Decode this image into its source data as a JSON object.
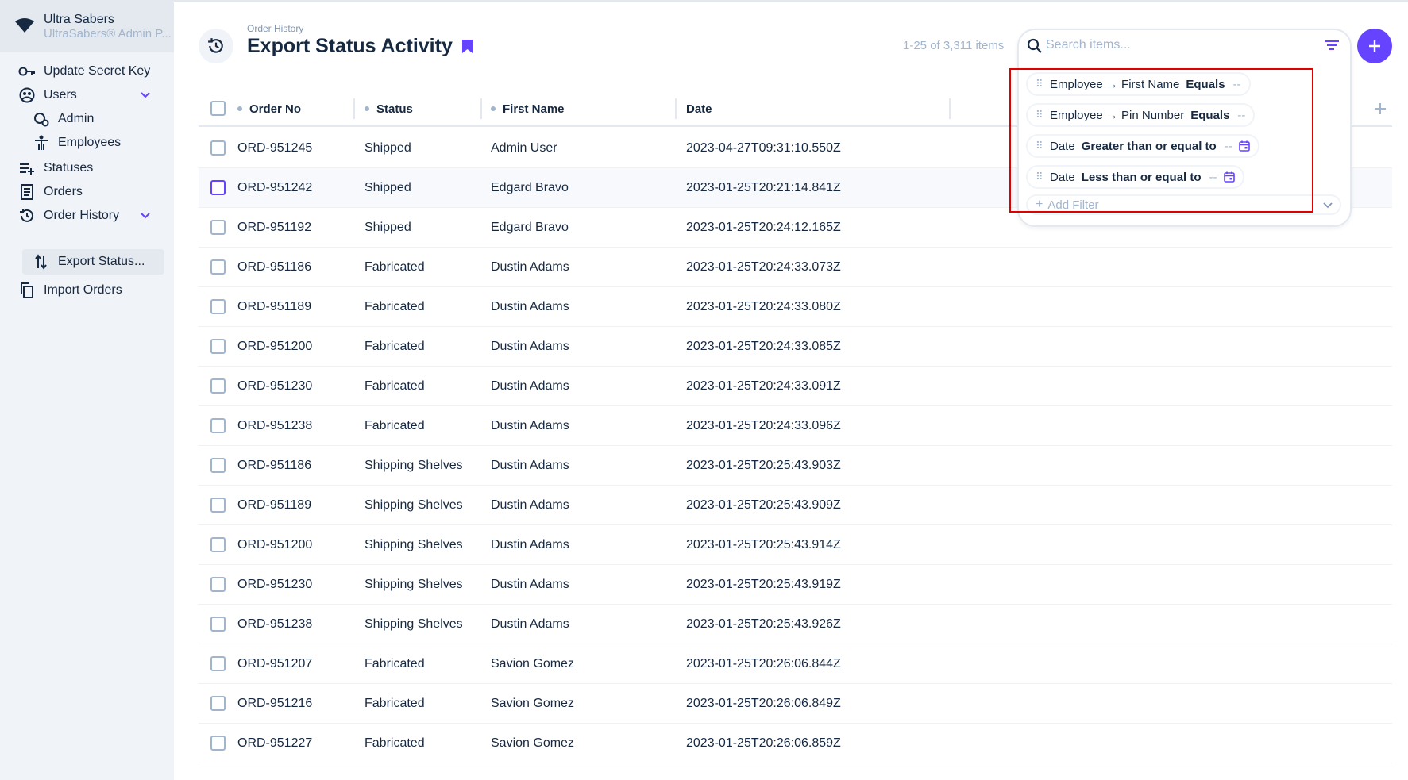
{
  "sidebar": {
    "brand_name": "Ultra Sabers",
    "brand_sub": "UltraSabers® Admin P...",
    "items": [
      {
        "label": "Update Secret Key",
        "icon": "key-icon"
      },
      {
        "label": "Users",
        "icon": "users-icon"
      },
      {
        "label": "Admin",
        "icon": "admin-icon"
      },
      {
        "label": "Employees",
        "icon": "employee-icon"
      },
      {
        "label": "Statuses",
        "icon": "playlist-add-icon"
      },
      {
        "label": "Orders",
        "icon": "receipt-icon"
      },
      {
        "label": "Order History",
        "icon": "history-icon"
      },
      {
        "label": "Export Status...",
        "icon": "swap-vert-icon"
      },
      {
        "label": "Import Orders",
        "icon": "copy-icon"
      }
    ]
  },
  "header": {
    "breadcrumb": "Order History",
    "title": "Export Status Activity",
    "count": "1-25 of 3,311 items"
  },
  "search": {
    "placeholder": "Search items...",
    "filters": [
      {
        "field": "Employee → First Name",
        "operator": "Equals",
        "value": "--",
        "has_calendar": false
      },
      {
        "field": "Employee → Pin Number",
        "operator": "Equals",
        "value": "--",
        "has_calendar": false
      },
      {
        "field": "Date",
        "operator": "Greater than or equal to",
        "value": "--",
        "has_calendar": true
      },
      {
        "field": "Date",
        "operator": "Less than or equal to",
        "value": "--",
        "has_calendar": true
      }
    ],
    "add_filter": "Add Filter"
  },
  "table": {
    "columns": [
      "Order No",
      "Status",
      "First Name",
      "Date"
    ],
    "rows": [
      [
        "ORD-951245",
        "Shipped",
        "Admin User",
        "2023-04-27T09:31:10.550Z"
      ],
      [
        "ORD-951242",
        "Shipped",
        "Edgard Bravo",
        "2023-01-25T20:21:14.841Z"
      ],
      [
        "ORD-951192",
        "Shipped",
        "Edgard Bravo",
        "2023-01-25T20:24:12.165Z"
      ],
      [
        "ORD-951186",
        "Fabricated",
        "Dustin Adams",
        "2023-01-25T20:24:33.073Z"
      ],
      [
        "ORD-951189",
        "Fabricated",
        "Dustin Adams",
        "2023-01-25T20:24:33.080Z"
      ],
      [
        "ORD-951200",
        "Fabricated",
        "Dustin Adams",
        "2023-01-25T20:24:33.085Z"
      ],
      [
        "ORD-951230",
        "Fabricated",
        "Dustin Adams",
        "2023-01-25T20:24:33.091Z"
      ],
      [
        "ORD-951238",
        "Fabricated",
        "Dustin Adams",
        "2023-01-25T20:24:33.096Z"
      ],
      [
        "ORD-951186",
        "Shipping Shelves",
        "Dustin Adams",
        "2023-01-25T20:25:43.903Z"
      ],
      [
        "ORD-951189",
        "Shipping Shelves",
        "Dustin Adams",
        "2023-01-25T20:25:43.909Z"
      ],
      [
        "ORD-951200",
        "Shipping Shelves",
        "Dustin Adams",
        "2023-01-25T20:25:43.914Z"
      ],
      [
        "ORD-951230",
        "Shipping Shelves",
        "Dustin Adams",
        "2023-01-25T20:25:43.919Z"
      ],
      [
        "ORD-951238",
        "Shipping Shelves",
        "Dustin Adams",
        "2023-01-25T20:25:43.926Z"
      ],
      [
        "ORD-951207",
        "Fabricated",
        "Savion Gomez",
        "2023-01-25T20:26:06.844Z"
      ],
      [
        "ORD-951216",
        "Fabricated",
        "Savion Gomez",
        "2023-01-25T20:26:06.849Z"
      ],
      [
        "ORD-951227",
        "Fabricated",
        "Savion Gomez",
        "2023-01-25T20:26:06.859Z"
      ]
    ]
  },
  "colors": {
    "accent": "#6644ff",
    "sidebar_bg": "#f0f3f7",
    "text": "#172940",
    "muted": "#a2b5cd",
    "annotation": "#e00000"
  }
}
